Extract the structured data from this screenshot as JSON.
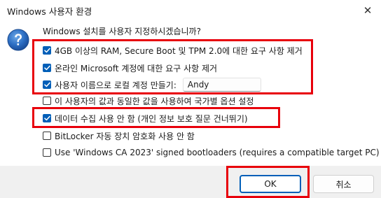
{
  "window": {
    "title": "Windows 사용자 환경",
    "close_glyph": "✕"
  },
  "dialog": {
    "question": "Windows 설치를 사용자 지정하시겠습니까?",
    "icon": "question-icon",
    "options": [
      {
        "label": "4GB 이상의 RAM, Secure Boot 및 TPM 2.0에 대한 요구 사항 제거",
        "checked": true
      },
      {
        "label": "온라인 Microsoft 계정에 대한 요구 사항 제거",
        "checked": true
      },
      {
        "label": "사용자 이름으로 로컬 계정 만들기:",
        "checked": true
      },
      {
        "label": "이 사용자의 값과 동일한 값을 사용하여 국가별 옵션 설정",
        "checked": false
      },
      {
        "label": "데이터 수집 사용 안 함 (개인 정보 보호 질문 건너뛰기)",
        "checked": true
      },
      {
        "label": "BitLocker 자동 장치 암호화 사용 안 함",
        "checked": false
      },
      {
        "label": "Use 'Windows CA 2023' signed bootloaders (requires a compatible target PC)",
        "checked": false
      }
    ],
    "username_value": "Andy"
  },
  "buttons": {
    "ok_label": "OK",
    "cancel_label": "취소"
  },
  "colors": {
    "accent": "#005fb8",
    "highlight": "#e8000b",
    "footer_bg": "#f0f0f0"
  }
}
